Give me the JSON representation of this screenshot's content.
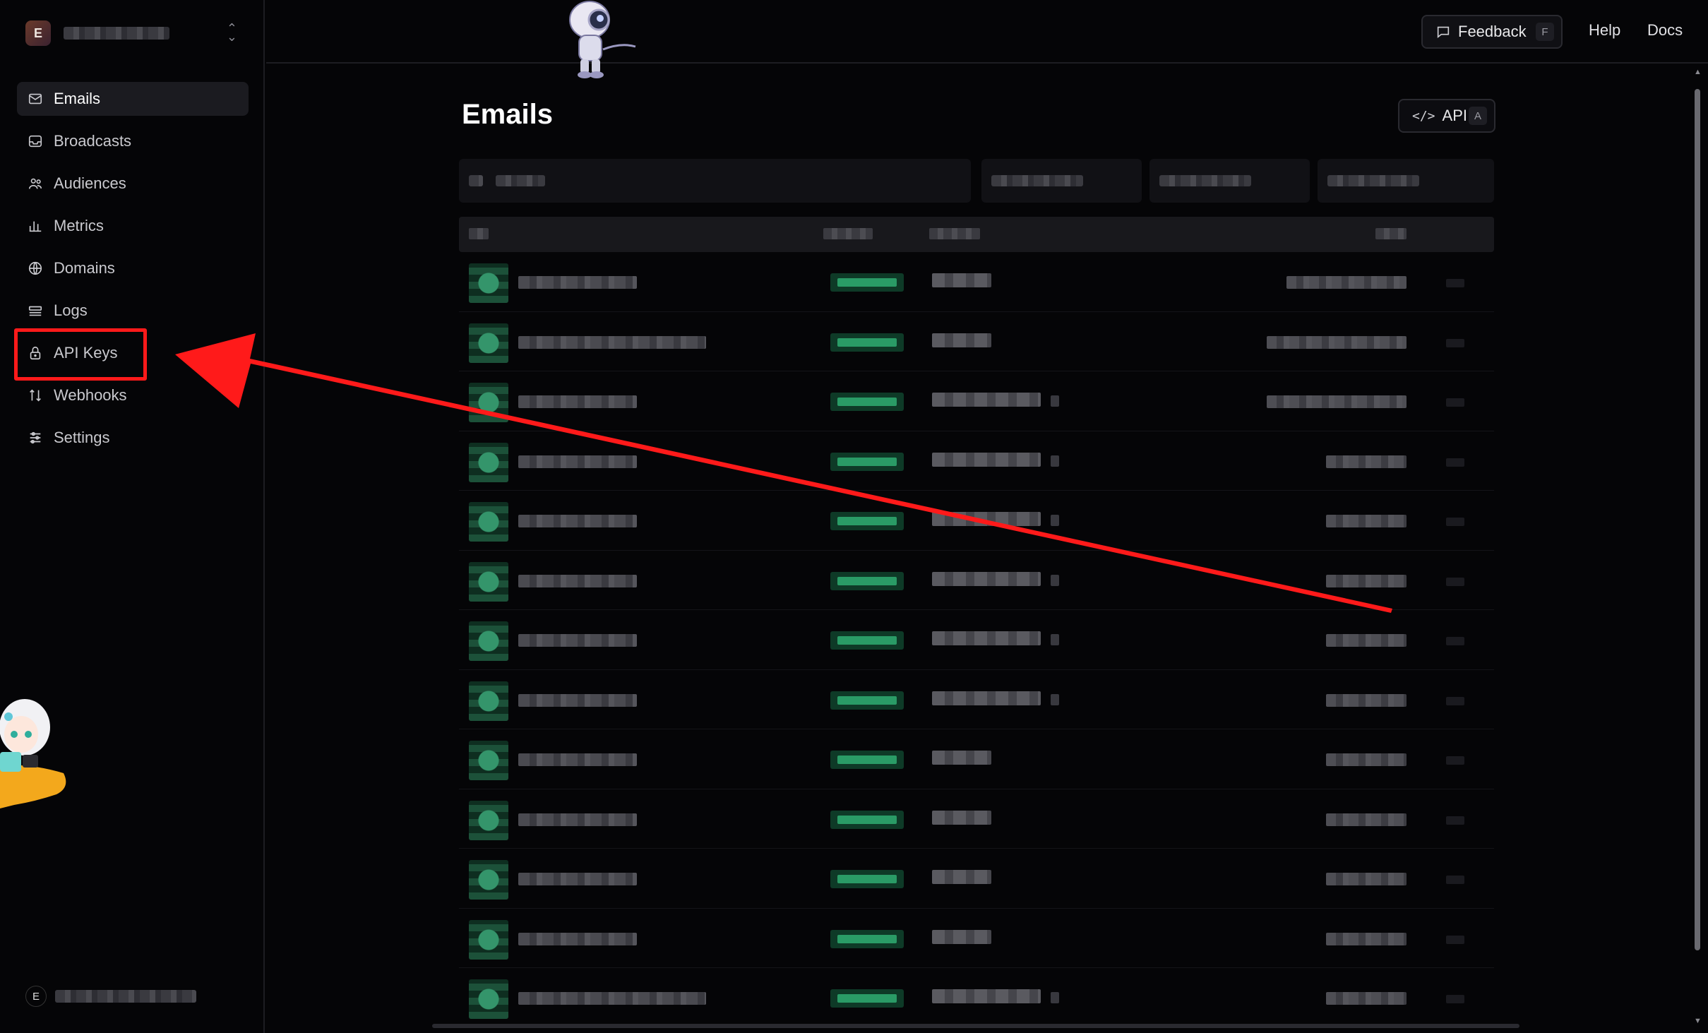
{
  "sidebar": {
    "team_initial": "E",
    "items": [
      {
        "label": "Emails",
        "icon": "mail-icon",
        "active": true
      },
      {
        "label": "Broadcasts",
        "icon": "inbox-icon",
        "active": false
      },
      {
        "label": "Audiences",
        "icon": "users-icon",
        "active": false
      },
      {
        "label": "Metrics",
        "icon": "bar-chart-icon",
        "active": false
      },
      {
        "label": "Domains",
        "icon": "globe-icon",
        "active": false
      },
      {
        "label": "Logs",
        "icon": "logs-icon",
        "active": false
      },
      {
        "label": "API Keys",
        "icon": "lock-icon",
        "active": false
      },
      {
        "label": "Webhooks",
        "icon": "webhook-icon",
        "active": false
      },
      {
        "label": "Settings",
        "icon": "sliders-icon",
        "active": false
      }
    ],
    "user_initial": "E"
  },
  "header": {
    "feedback_label": "Feedback",
    "feedback_shortcut": "F",
    "help_label": "Help",
    "docs_label": "Docs"
  },
  "main": {
    "title": "Emails",
    "api_label": "API",
    "api_shortcut": "A",
    "api_icon": "code-icon"
  },
  "colors": {
    "annotation": "#ff1a1a",
    "status_green": "#2a9b66",
    "background": "#050507"
  }
}
